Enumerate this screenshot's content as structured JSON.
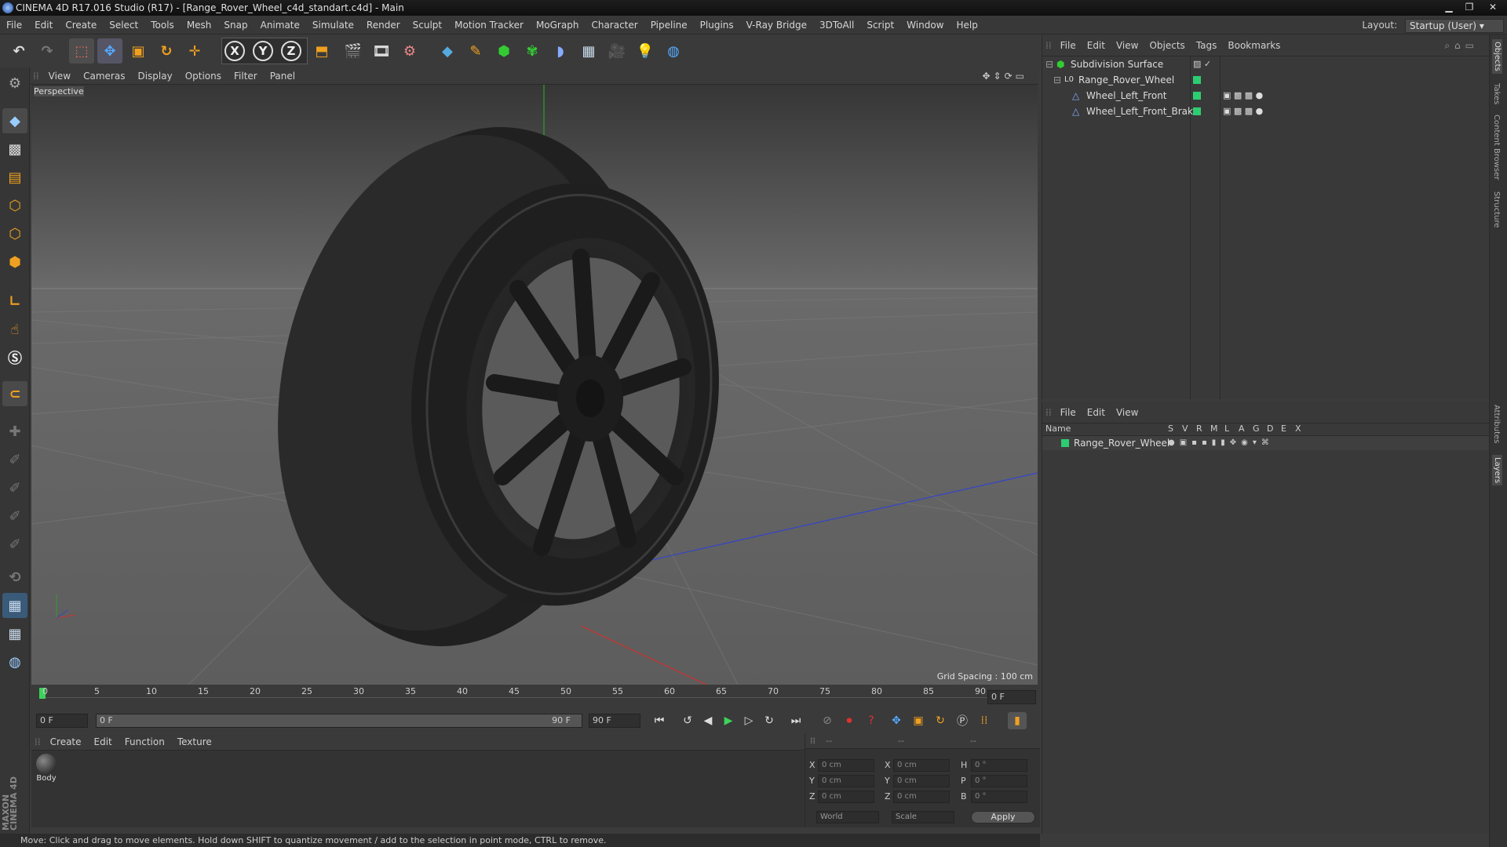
{
  "window": {
    "title": "CINEMA 4D R17.016 Studio (R17) - [Range_Rover_Wheel_c4d_standart.c4d] - Main"
  },
  "menu": [
    "File",
    "Edit",
    "Create",
    "Select",
    "Tools",
    "Mesh",
    "Snap",
    "Animate",
    "Simulate",
    "Render",
    "Sculpt",
    "Motion Tracker",
    "MoGraph",
    "Character",
    "Pipeline",
    "Plugins",
    "V-Ray Bridge",
    "3DToAll",
    "Script",
    "Window",
    "Help"
  ],
  "layout": {
    "label": "Layout:",
    "value": "Startup (User)"
  },
  "toolbar_axes": [
    "X",
    "Y",
    "Z"
  ],
  "viewport": {
    "menu": [
      "View",
      "Cameras",
      "Display",
      "Options",
      "Filter",
      "Panel"
    ],
    "label": "Perspective",
    "grid_spacing": "Grid Spacing : 100 cm"
  },
  "timeline": {
    "ticks": [
      "0",
      "5",
      "10",
      "15",
      "20",
      "25",
      "30",
      "35",
      "40",
      "45",
      "50",
      "55",
      "60",
      "65",
      "70",
      "75",
      "80",
      "85",
      "90"
    ],
    "current_frame": "0 F",
    "start_field": "0 F",
    "range_start": "0 F",
    "range_end": "90 F",
    "end_field": "90 F"
  },
  "material_panel": {
    "menu": [
      "Create",
      "Edit",
      "Function",
      "Texture"
    ],
    "materials": [
      {
        "name": "Body"
      }
    ]
  },
  "coordinates": {
    "headers": [
      "--",
      "--",
      "--"
    ],
    "rows": [
      {
        "a": "X",
        "av": "0 cm",
        "b": "X",
        "bv": "0 cm",
        "c": "H",
        "cv": "0 °"
      },
      {
        "a": "Y",
        "av": "0 cm",
        "b": "Y",
        "bv": "0 cm",
        "c": "P",
        "cv": "0 °"
      },
      {
        "a": "Z",
        "av": "0 cm",
        "b": "Z",
        "bv": "0 cm",
        "c": "B",
        "cv": "0 °"
      }
    ],
    "world": "World",
    "scale": "Scale",
    "apply": "Apply"
  },
  "object_manager": {
    "menu": [
      "File",
      "Edit",
      "View",
      "Objects",
      "Tags",
      "Bookmarks"
    ],
    "objects": [
      {
        "name": "Subdivision Surface",
        "indent": 0
      },
      {
        "name": "Range_Rover_Wheel",
        "indent": 1
      },
      {
        "name": "Wheel_Left_Front",
        "indent": 2
      },
      {
        "name": "Wheel_Left_Front_Brake",
        "indent": 2
      }
    ]
  },
  "layer_manager": {
    "menu": [
      "File",
      "Edit",
      "View"
    ],
    "columns": [
      "Name",
      "S",
      "V",
      "R",
      "M",
      "L",
      "A",
      "G",
      "D",
      "E",
      "X"
    ],
    "layers": [
      {
        "name": "Range_Rover_Wheel"
      }
    ]
  },
  "right_tabs": [
    "Objects",
    "Takes",
    "Content Browser",
    "Structure",
    "Attributes",
    "Layers"
  ],
  "status": "Move: Click and drag to move elements. Hold down SHIFT to quantize movement / add to the selection in point mode, CTRL to remove.",
  "brand": {
    "line1": "MAXON",
    "line2": "CINEMA 4D"
  },
  "colors": {
    "accent_green": "#2ecc71",
    "play_green": "#3cd35a",
    "record_red": "#e03030",
    "orange": "#f0a020"
  }
}
